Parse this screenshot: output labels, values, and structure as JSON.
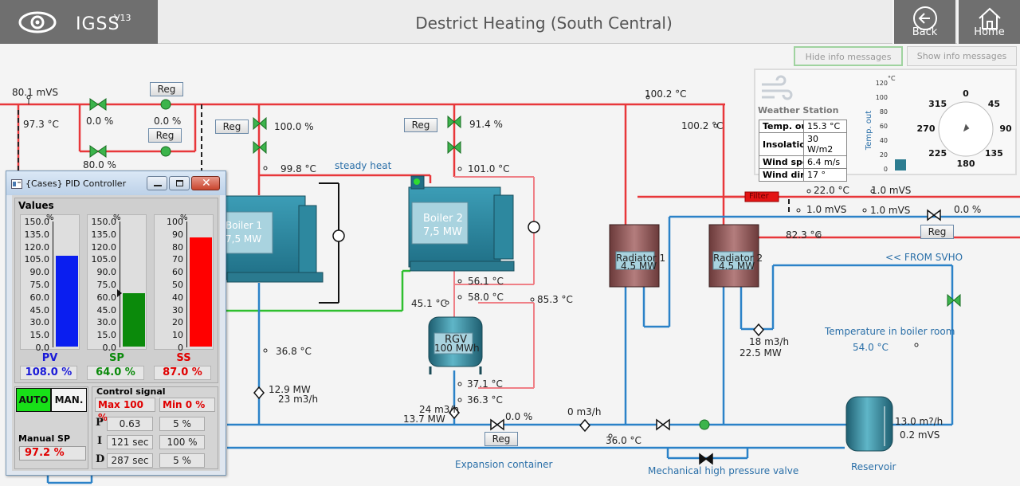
{
  "header": {
    "app_name": "IGSS",
    "app_version": "V13",
    "title": "Destrict Heating (South Central)",
    "back_label": "Back",
    "home_label": "Home",
    "hide_info_label": "Hide info messages",
    "show_info_label": "Show info messages"
  },
  "diagram": {
    "top_left_mvs": "80.1 mVS",
    "top_left_temp": "97.3 °C",
    "valve1_pct": "0.0 %",
    "valve2_pct": "0.0 %",
    "valve3_pct": "80.0 %",
    "valve4_pct": "0.0 %",
    "reg_label": "Reg",
    "boiler1_valve_pct": "100.0 %",
    "boiler1_temp": "99.8 °C",
    "boiler1_name": "Boiler 1",
    "boiler1_power": "7,5 MW",
    "steady_heat": "steady heat",
    "boiler2_valve_pct": "91.4 %",
    "boiler2_temp": "101.0 °C",
    "boiler2_name": "Boiler 2",
    "boiler2_power": "7,5 MW",
    "boiler2_out_temp": "56.1 °C",
    "rgv_in_temp": "58.0 °C",
    "rgv_left_temp": "45.1 °C",
    "rgv_right_temp": "85.3 °C",
    "rgv_name": "RGV",
    "rgv_volume": "100 MWh",
    "rgv_bottom_temp1": "37.1 °C",
    "rgv_bottom_temp2": "36.3 °C",
    "return_temp": "36.8 °C",
    "flow1_mw": "12.9 MW",
    "flow1_m3h": "23 m3/h",
    "flow2_m3h": "24 m3/h",
    "flow2_mw": "13.7 MW",
    "pump_pct": "0.0 %",
    "bottom_flow": "0 m3/h",
    "bottom_temp": "36.0 °C",
    "expansion": "Expansion container",
    "mech_valve": "Mechanical high pressure valve",
    "supply_temp1": "100.2 °C",
    "supply_temp2": "100.2 °C",
    "filter": "Filter",
    "filter_temp": "22.0 °C",
    "filter_mvs1": "1.0 mVS",
    "filter_mvs2": "1.0 mVS",
    "filter_mvs3": "1.0 mVS",
    "right_valve_pct": "0.0 %",
    "rad_temp": "82.3 °C",
    "radiator1_name": "Radiator 1",
    "radiator1_power": "4.5 MW",
    "radiator2_name": "Radiator 2",
    "radiator2_power": "4.5 MW",
    "from_svho": "<< FROM SVHO",
    "rad_flow_m3h": "18 m3/h",
    "rad_flow_mw": "22.5 MW",
    "boiler_room_label": "Temperature in boiler room",
    "boiler_room_temp": "54.0 °C",
    "reservoir": "Reservoir",
    "reservoir_flow": "13.0 m?/h",
    "reservoir_mvs": "0.2 mVS"
  },
  "weather": {
    "title": "Weather Station",
    "rows": [
      {
        "key": "Temp. out",
        "value": "15.3 °C"
      },
      {
        "key": "Insolation",
        "value": "30 W/m2"
      },
      {
        "key": "Wind speed",
        "value": "6.4 m/s"
      },
      {
        "key": "Wind dir.",
        "value": "17 °"
      }
    ],
    "gauge_unit": "°C",
    "gauge_ticks": [
      "120",
      "100",
      "80",
      "60",
      "40",
      "20",
      "0"
    ],
    "gauge_axis_label": "Temp. out",
    "gauge_value_c": 15.3,
    "compass": [
      "0",
      "45",
      "90",
      "135",
      "180",
      "225",
      "270",
      "315"
    ],
    "wind_dir_deg": 17
  },
  "pid": {
    "window_title": "{Cases} PID Controller",
    "values_label": "Values",
    "gauges": [
      {
        "name": "PV",
        "ticks": [
          "150.0",
          "135.0",
          "120.0",
          "105.0",
          "90.0",
          "75.0",
          "60.0",
          "45.0",
          "30.0",
          "15.0",
          "0.0"
        ],
        "unit": "%",
        "value_text": "108.0 %",
        "fill_fraction": 0.72,
        "color": "#0a1ef0",
        "text_color": "#1a1ad8"
      },
      {
        "name": "SP",
        "ticks": [
          "150.0",
          "135.0",
          "120.0",
          "105.0",
          "90.0",
          "75.0",
          "60.0",
          "45.0",
          "30.0",
          "15.0",
          "0.0"
        ],
        "unit": "%",
        "value_text": "64.0 %",
        "fill_fraction": 0.427,
        "color": "#0b8a0b",
        "text_color": "#0b8a0b"
      },
      {
        "name": "SS",
        "ticks": [
          "100",
          "90",
          "80",
          "70",
          "60",
          "50",
          "40",
          "30",
          "20",
          "10",
          "0"
        ],
        "unit": "%",
        "value_text": "87.0 %",
        "fill_fraction": 0.87,
        "color": "#ff0000",
        "text_color": "#e00000"
      }
    ],
    "auto_label": "AUTO",
    "manual_label": "MAN.",
    "manual_sp_label": "Manual SP reg.",
    "manual_sp_value": "97.2 %",
    "control_signal_label": "Control signal",
    "max_label": "Max  100 %",
    "min_label": "Min    0 %",
    "params": [
      {
        "key": "P",
        "a": "0.63",
        "b": "5 %"
      },
      {
        "key": "I",
        "a": "121 sec",
        "b": "100 %"
      },
      {
        "key": "D",
        "a": "287 sec",
        "b": "5 %"
      }
    ]
  }
}
